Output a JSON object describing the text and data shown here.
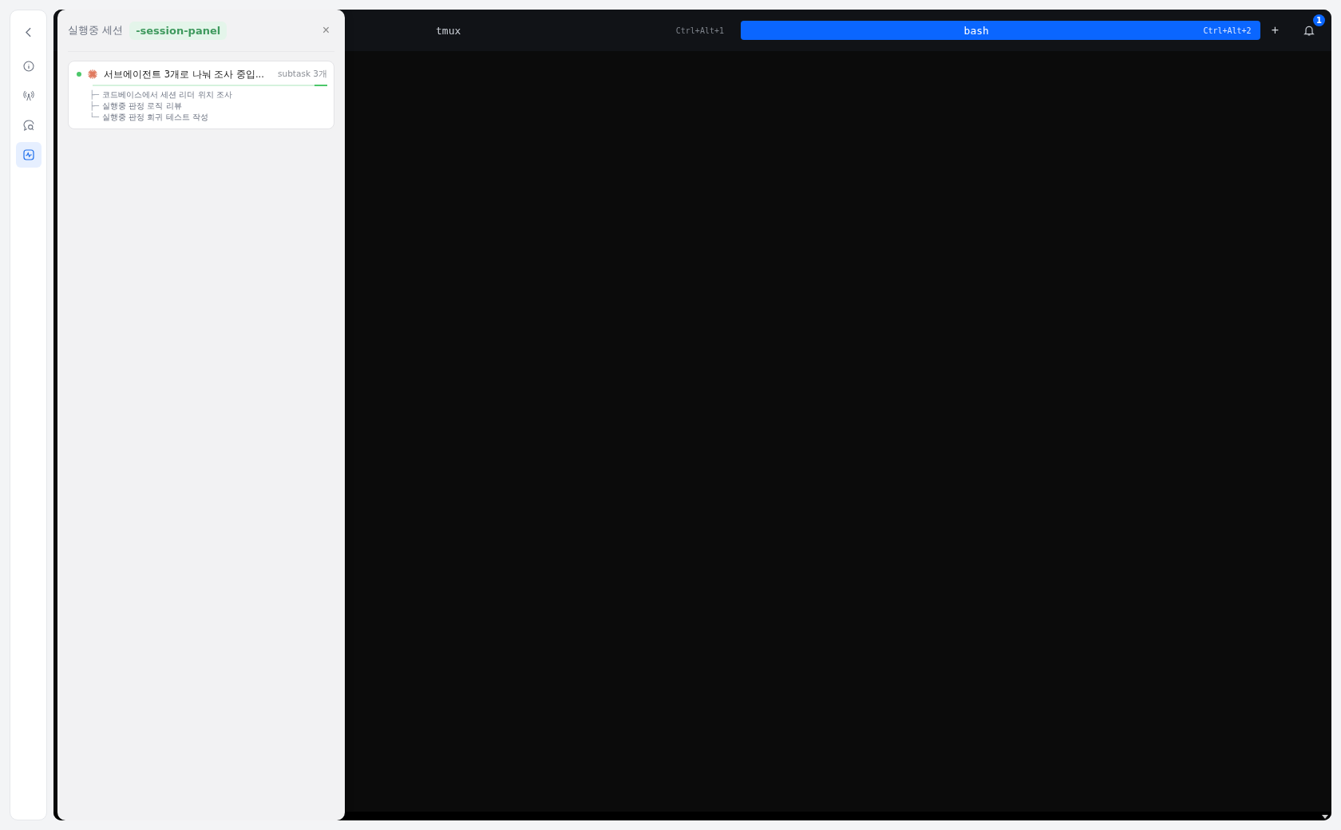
{
  "sidebar": {
    "items": [
      {
        "selected": false
      },
      {
        "selected": false
      },
      {
        "selected": false
      },
      {
        "selected": true
      }
    ]
  },
  "terminal": {
    "tabs": [
      {
        "label": "tmux",
        "shortcut": "Ctrl+Alt+1",
        "selected": false
      },
      {
        "label": "bash",
        "shortcut": "Ctrl+Alt+2",
        "selected": true
      }
    ],
    "add_button": "+",
    "notification_count": "1"
  },
  "panel": {
    "title": "실행중 세션",
    "debug_tag": "-session-panel",
    "close": "×",
    "sessions": [
      {
        "color": "#4cc76a",
        "title": "서브에이전트 3개로 나눠 조사 중입...",
        "badge": "subtask 3개",
        "subtasks": [
          {
            "branch": "├─",
            "text": "코드베이스에서 세션 리더 위치 조사"
          },
          {
            "branch": "├─",
            "text": "실행중 판정 로직 리뷰"
          },
          {
            "branch": "└─",
            "text": "실행중 판정 회귀 테스트 작성"
          }
        ]
      }
    ]
  }
}
